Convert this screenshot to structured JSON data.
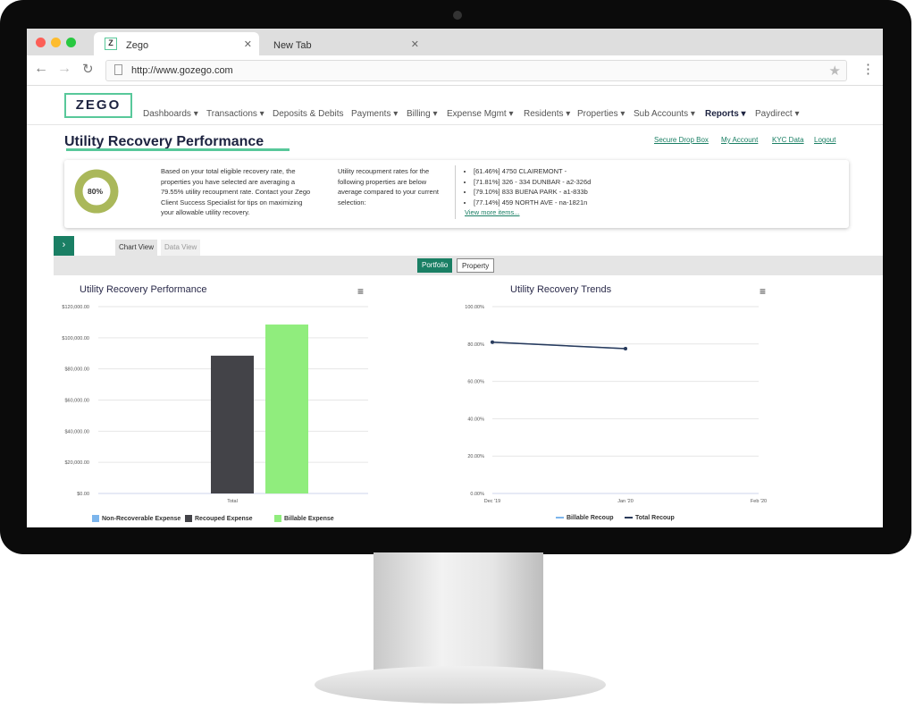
{
  "browser": {
    "tabs": [
      {
        "title": "Zego",
        "favicon": "Z",
        "active": true
      },
      {
        "title": "New Tab",
        "active": false
      }
    ],
    "url": "http://www.gozego.com"
  },
  "brand": {
    "logo": "ZEGO",
    "accent": "#1a7f64",
    "highlight": "#58c89a"
  },
  "nav": [
    "Dashboards ▾",
    "Transactions ▾",
    "Deposits & Debits",
    "Payments ▾",
    "Billing ▾",
    "Expense Mgmt ▾",
    "Residents ▾",
    "Properties ▾",
    "Sub Accounts ▾",
    "Reports ▾",
    "Paydirect ▾"
  ],
  "nav_active": "Reports ▾",
  "page_title": "Utility Recovery Performance",
  "top_links": [
    "Secure Drop Box",
    "My Account",
    "KYC Data",
    "Logout"
  ],
  "summary": {
    "gauge_label": "80%",
    "gauge_value": 80,
    "gauge_color": "#aab85a",
    "text": "Based on your total eligible recovery rate, the properties you have selected are averaging a 79.55% utility recoupment rate. Contact your Zego Client Success Specialist for tips on maximizing your allowable utility recovery.",
    "below_text": "Utility recoupment rates for the following properties are below average compared to your current selection:",
    "items": [
      "[61.46%] 4750 CLAIREMONT -",
      "[71.81%] 326 - 334 DUNBAR - a2-326d",
      "[79.10%] 833 BUENA PARK - a1-833b",
      "[77.14%] 459 NORTH AVE - na-1821n"
    ],
    "more": "View more items..."
  },
  "view_tabs": [
    "Chart View",
    "Data View"
  ],
  "toggle": [
    "Portfolio",
    "Property"
  ],
  "chart_data": [
    {
      "type": "bar",
      "title": "Utility Recovery Performance",
      "categories": [
        "Total"
      ],
      "series": [
        {
          "name": "Non-Recoverable Expense",
          "values": [
            0
          ],
          "color": "#7cb5ec"
        },
        {
          "name": "Recouped Expense",
          "values": [
            88500
          ],
          "color": "#434348"
        },
        {
          "name": "Billable Expense",
          "values": [
            108500
          ],
          "color": "#90ed7d"
        }
      ],
      "ylim": [
        0,
        120000
      ],
      "yticks": [
        "$0.00",
        "$20,000.00",
        "$40,000.00",
        "$60,000.00",
        "$80,000.00",
        "$100,000.00",
        "$120,000.00"
      ],
      "legend": "bottom",
      "grid": true
    },
    {
      "type": "line",
      "title": "Utility Recovery Trends",
      "x": [
        "Dec '19",
        "Jan '20",
        "Feb '20"
      ],
      "series": [
        {
          "name": "Billable Recoup",
          "values": [
            81,
            77.5,
            null
          ],
          "color": "#7cb5ec"
        },
        {
          "name": "Total Recoup",
          "values": [
            81,
            77.5,
            null
          ],
          "color": "#2a3a5a"
        }
      ],
      "ylim": [
        0,
        100
      ],
      "yticks": [
        "0.00%",
        "20.00%",
        "40.00%",
        "60.00%",
        "80.00%",
        "100.00%"
      ],
      "legend": "bottom",
      "grid": true
    }
  ]
}
